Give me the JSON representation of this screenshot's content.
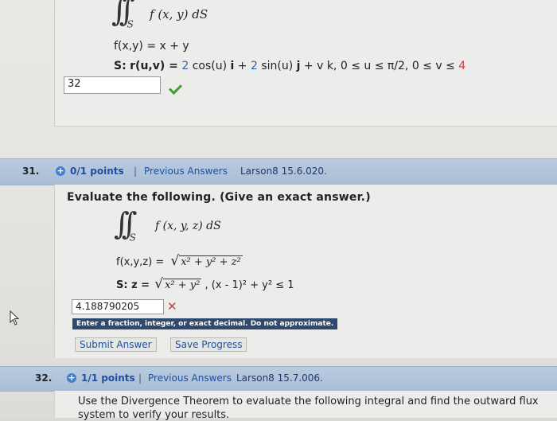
{
  "q30": {
    "integral_expr": "f (x, y) dS",
    "integral_sub": "S",
    "f_def": "f(x,y) = x + y",
    "s_prefix": "S:",
    "s_r": "r(u,v) =",
    "s_coef1": "2",
    "s_cos": "cos(u)",
    "s_i": "i",
    "s_plus1": "+",
    "s_coef2": "2",
    "s_sin": "sin(u)",
    "s_j": "j",
    "s_rest": "+ v k, 0 ≤ u ≤ π/2, 0 ≤ v ≤",
    "s_bound": "4",
    "answer": "32"
  },
  "q31": {
    "number": "31.",
    "points": "0/1 points",
    "separator": "|",
    "previous": "Previous Answers",
    "source": "Larson8 15.6.020.",
    "prompt": "Evaluate the following. (Give an exact answer.)",
    "integral_expr": "f (x, y, z) dS",
    "integral_sub": "S",
    "f_label": "f(x,y,z) =",
    "f_rad": "x² + y² + z²",
    "s_label": "S: z =",
    "s_rad": "x² + y²",
    "s_cond": ", (x - 1)² + y² ≤ 1",
    "answer": "4.188790205",
    "tooltip": "Enter a fraction, integer, or exact decimal. Do not approximate.",
    "submit": "Submit Answer",
    "save": "Save Progress"
  },
  "q32": {
    "number": "32.",
    "points": "1/1 points",
    "separator": "|",
    "previous": "Previous Answers",
    "source": "Larson8 15.7.006.",
    "prompt_line1": "Use the Divergence Theorem to evaluate the following integral and find the outward flux",
    "prompt_line2": "system to verify your results."
  },
  "colors": {
    "accent": "#1f4f9c",
    "correct": "#3ea02f",
    "incorrect": "#d23b3b",
    "header_bar": "#b9cbe0"
  }
}
